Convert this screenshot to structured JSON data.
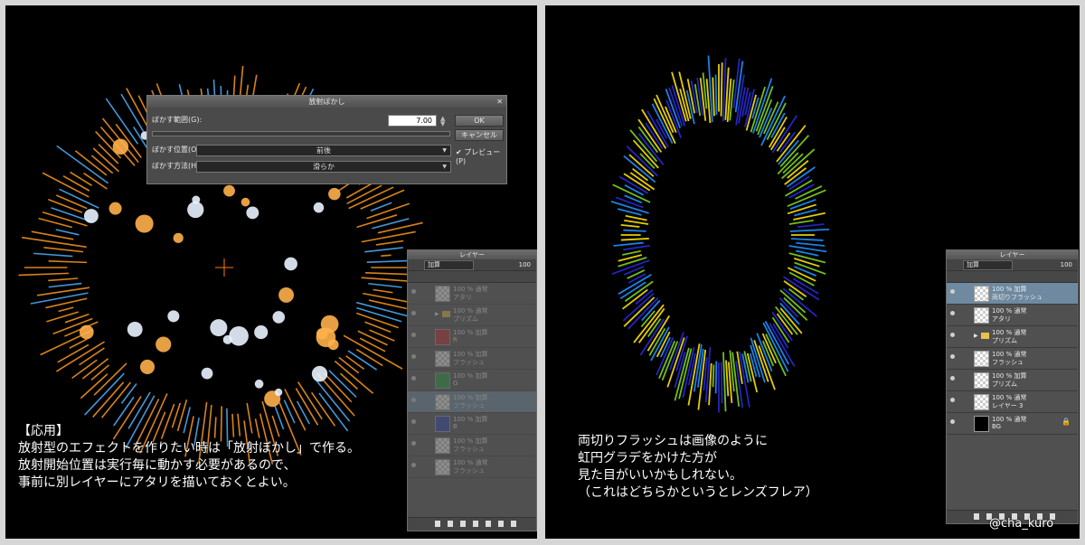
{
  "left": {
    "caption": [
      "【応用】",
      "放射型のエフェクトを作りたい時は「放射ぼかし」で作る。",
      "放射開始位置は実行毎に動かす必要があるので、",
      "事前に別レイヤーにアタリを描いておくとよい。"
    ],
    "dialog": {
      "title": "放射ぼかし",
      "range_label": "ぼかす範囲(G):",
      "range_value": "7.00",
      "position_label": "ぼかす位置(O):",
      "position_value": "前後",
      "method_label": "ぼかす方法(H):",
      "method_value": "滑らか",
      "ok": "OK",
      "cancel": "キャンセル",
      "preview": "プレビュー(P)"
    },
    "layers": {
      "title": "レイヤー",
      "blend": "加算",
      "opacity": "100",
      "rows": [
        {
          "mode": "100 % 通常",
          "name": "アタリ"
        },
        {
          "mode": "100 % 通常",
          "name": "プリズム"
        },
        {
          "mode": "100 % 加算",
          "name": "R"
        },
        {
          "mode": "100 % 加算",
          "name": "フラッシュ"
        },
        {
          "mode": "100 % 加算",
          "name": "G"
        },
        {
          "mode": "100 % 加算",
          "name": "フラッシュ"
        },
        {
          "mode": "100 % 加算",
          "name": "B"
        },
        {
          "mode": "100 % 加算",
          "name": "フラッシュ"
        },
        {
          "mode": "100 % 通常",
          "name": "フラッシュ"
        }
      ]
    }
  },
  "right": {
    "caption": [
      "両切りフラッシュは画像のように",
      "虹円グラデをかけた方が",
      "見た目がいいかもしれない。",
      "（これはどちらかというとレンズフレア）"
    ],
    "layers": {
      "title": "レイヤー",
      "blend": "加算",
      "opacity": "100",
      "rows": [
        {
          "mode": "100 % 加算",
          "name": "両切りフラッシュ"
        },
        {
          "mode": "100 % 通常",
          "name": "アタリ"
        },
        {
          "mode": "100 % 通常",
          "name": "プリズム"
        },
        {
          "mode": "100 % 通常",
          "name": "フラッシュ"
        },
        {
          "mode": "100 % 加算",
          "name": "プリズム"
        },
        {
          "mode": "100 % 通常",
          "name": "レイヤー 3"
        },
        {
          "mode": "100 % 通常",
          "name": "BG"
        }
      ]
    }
  },
  "credit": "@cha_kuro",
  "colors": {
    "rays_warm": "#ff9a1e",
    "rays_cool": "#4fb2ff",
    "rainbow": [
      "#ffe400",
      "#7ed321",
      "#1e90ff",
      "#2a2ad8"
    ]
  },
  "icons": [
    "crosshair-icon",
    "close-icon",
    "eye-icon",
    "folder-icon",
    "lock-icon",
    "checkbox-icon"
  ]
}
